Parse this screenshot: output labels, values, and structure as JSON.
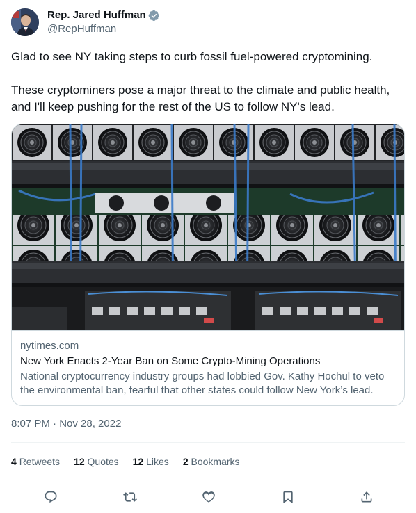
{
  "author": {
    "display_name": "Rep. Jared Huffman",
    "handle": "@RepHuffman",
    "verified": true
  },
  "tweet": {
    "paragraphs": [
      "Glad to see NY taking steps to curb fossil fuel-powered cryptomining.",
      "These cryptominers pose a major threat to the climate and public health, and I'll keep pushing for the rest of the US to follow NY's lead."
    ],
    "timestamp": "8:07 PM · Nov 28, 2022"
  },
  "link_card": {
    "domain": "nytimes.com",
    "title": "New York Enacts 2-Year Ban on Some Crypto-Mining Operations",
    "description": "National cryptocurrency industry groups had lobbied Gov. Kathy Hochul to veto the environmental ban, fearful that other states could follow New York’s lead."
  },
  "stats": {
    "retweets": {
      "count": "4",
      "label": "Retweets"
    },
    "quotes": {
      "count": "12",
      "label": "Quotes"
    },
    "likes": {
      "count": "12",
      "label": "Likes"
    },
    "bookmarks": {
      "count": "2",
      "label": "Bookmarks"
    }
  },
  "actions": [
    "reply-icon",
    "retweet-icon",
    "like-icon",
    "bookmark-icon",
    "share-icon"
  ],
  "colors": {
    "text": "#0f1419",
    "secondary": "#536471",
    "border": "#cfd9de",
    "verified": "#829aab"
  }
}
